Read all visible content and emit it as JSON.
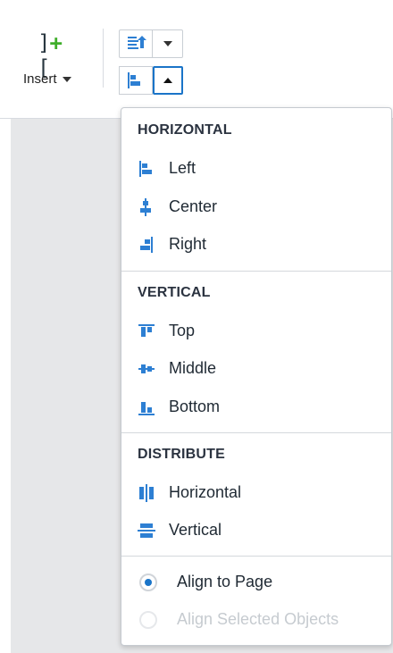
{
  "colors": {
    "accent": "#1a74c8",
    "icon_blue": "#2d7fd3",
    "plus_green": "#3fae2a"
  },
  "toolbar": {
    "insert": {
      "icon_left": "]",
      "icon_plus": "+",
      "icon_right": "[",
      "label": "Insert"
    },
    "arrange_button_icon": "bring-forward-icon",
    "align_button_icon": "align-left-icon"
  },
  "menu": {
    "horizontal": {
      "header": "HORIZONTAL",
      "items": [
        {
          "label": "Left",
          "icon": "align-left-icon"
        },
        {
          "label": "Center",
          "icon": "align-center-icon"
        },
        {
          "label": "Right",
          "icon": "align-right-icon"
        }
      ]
    },
    "vertical": {
      "header": "VERTICAL",
      "items": [
        {
          "label": "Top",
          "icon": "align-top-icon"
        },
        {
          "label": "Middle",
          "icon": "align-middle-icon"
        },
        {
          "label": "Bottom",
          "icon": "align-bottom-icon"
        }
      ]
    },
    "distribute": {
      "header": "DISTRIBUTE",
      "items": [
        {
          "label": "Horizontal",
          "icon": "distribute-horizontal-icon"
        },
        {
          "label": "Vertical",
          "icon": "distribute-vertical-icon"
        }
      ]
    },
    "align_to": {
      "options": [
        {
          "label": "Align to Page",
          "selected": true,
          "enabled": true
        },
        {
          "label": "Align Selected Objects",
          "selected": false,
          "enabled": false
        }
      ]
    }
  }
}
